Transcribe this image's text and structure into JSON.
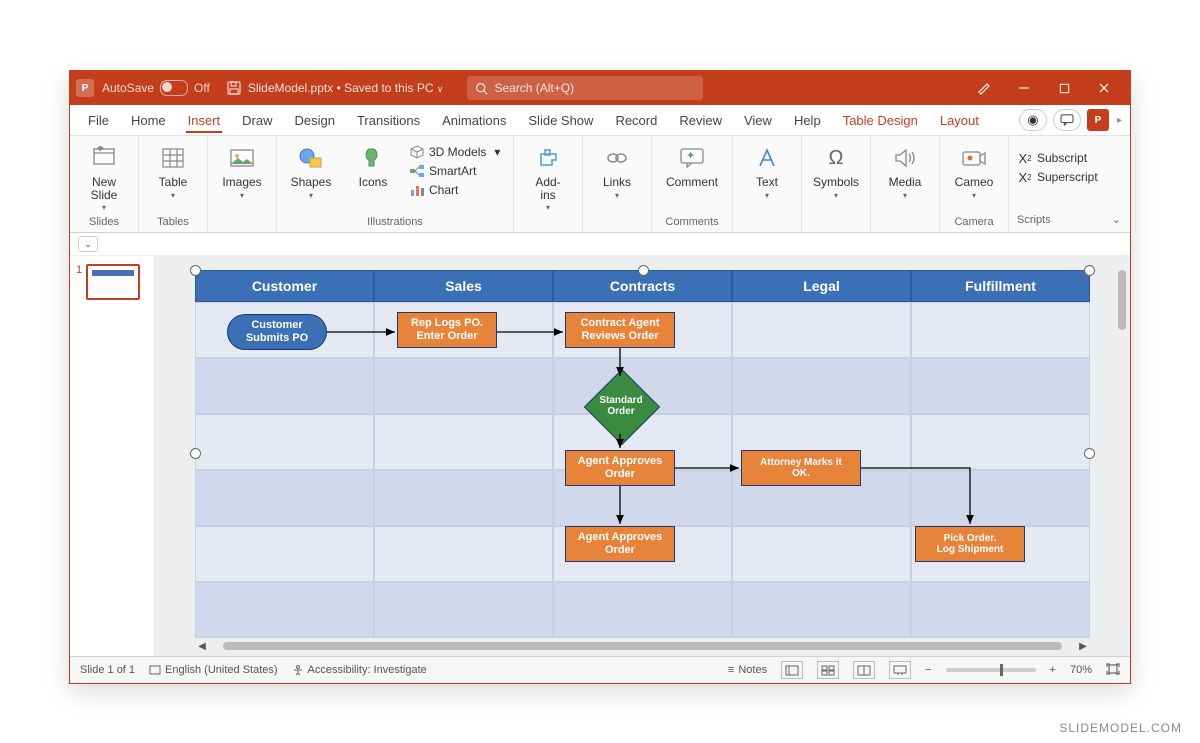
{
  "titlebar": {
    "autosave_label": "AutoSave",
    "autosave_state": "Off",
    "filename": "SlideModel.pptx",
    "saved_state": "Saved to this PC",
    "search_placeholder": "Search (Alt+Q)"
  },
  "tabs": {
    "items": [
      "File",
      "Home",
      "Insert",
      "Draw",
      "Design",
      "Transitions",
      "Animations",
      "Slide Show",
      "Record",
      "Review",
      "View",
      "Help",
      "Table Design",
      "Layout"
    ],
    "active": "Insert"
  },
  "ribbon": {
    "groups": {
      "slides": {
        "label": "Slides",
        "new_slide": "New\nSlide"
      },
      "tables": {
        "label": "Tables",
        "table": "Table"
      },
      "images": {
        "label": "",
        "images": "Images"
      },
      "illustrations": {
        "label": "Illustrations",
        "shapes": "Shapes",
        "icons": "Icons",
        "models3d": "3D Models",
        "smartart": "SmartArt",
        "chart": "Chart"
      },
      "addins": {
        "label": "",
        "addins": "Add-\nins"
      },
      "links": {
        "label": "",
        "links": "Links"
      },
      "comments": {
        "label": "Comments",
        "comment": "Comment"
      },
      "text": {
        "label": "",
        "text": "Text"
      },
      "symbols": {
        "label": "",
        "symbols": "Symbols"
      },
      "media": {
        "label": "",
        "media": "Media"
      },
      "camera": {
        "label": "Camera",
        "cameo": "Cameo"
      },
      "scripts": {
        "label": "Scripts",
        "subscript": "Subscript",
        "superscript": "Superscript"
      }
    }
  },
  "thumbnail": {
    "number": "1"
  },
  "swimlanes": {
    "headers": [
      "Customer",
      "Sales",
      "Contracts",
      "Legal",
      "Fulfillment"
    ],
    "shapes": {
      "start": "Customer\nSubmits PO",
      "rep_logs": "Rep Logs PO.\nEnter Order",
      "contract_review": "Contract Agent\nReviews Order",
      "decision": "Standard\nOrder",
      "agent_approves1": "Agent Approves\nOrder",
      "attorney": "Attorney Marks it\nOK.",
      "agent_approves2": "Agent Approves\nOrder",
      "pick_order": "Pick Order.\nLog Shipment"
    }
  },
  "statusbar": {
    "slide": "Slide 1 of 1",
    "language": "English (United States)",
    "accessibility": "Accessibility: Investigate",
    "notes": "Notes",
    "zoom": "70%"
  },
  "watermark": "SLIDEMODEL.COM"
}
